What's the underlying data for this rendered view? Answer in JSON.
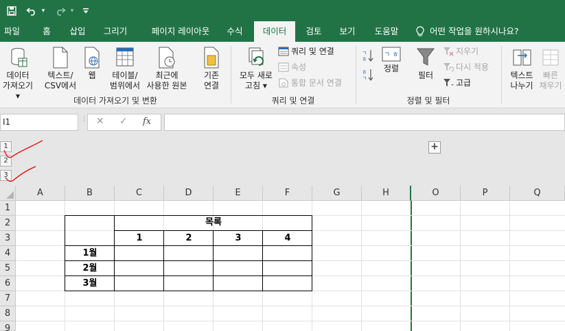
{
  "quick_access": {
    "save_icon": "save-icon",
    "undo_icon": "undo-icon",
    "redo_icon": "redo-icon",
    "customize_icon": "customize-icon",
    "dropdown_glyph": "▾"
  },
  "tabs": [
    "파일",
    "홈",
    "삽입",
    "그리기",
    "페이지 레이아웃",
    "수식",
    "데이터",
    "검토",
    "보기",
    "도움말"
  ],
  "active_tab": "데이터",
  "tell_me": "어떤 작업을 원하시나요?",
  "ribbon": {
    "get_data": {
      "line1": "데이터",
      "line2": "가져오기 ▾"
    },
    "from_text_csv": {
      "line1": "텍스트/",
      "line2": "CSV에서"
    },
    "from_web": "웹",
    "from_table": {
      "line1": "테이블/",
      "line2": "범위에서"
    },
    "recent_sources": {
      "line1": "최근에",
      "line2": "사용한 원본"
    },
    "existing_connections": {
      "line1": "기존",
      "line2": "연결"
    },
    "group_get_transform": "데이터 가져오기 및 변환",
    "refresh_all": {
      "line1": "모두 새로",
      "line2": "고침 ▾"
    },
    "queries_connections": "쿼리 및 연결",
    "properties": "속성",
    "edit_links": "통합 문서 연결",
    "group_queries": "쿼리 및 연결",
    "sort": "정렬",
    "filter": "필터",
    "clear": "지우기",
    "reapply": "다시 적용",
    "advanced": "고급",
    "group_sort_filter": "정렬 및 필터",
    "text_to_columns": {
      "line1": "텍스트",
      "line2": "나누기"
    },
    "flash_fill": {
      "line1": "빠른",
      "line2": "채우기"
    }
  },
  "formula_bar": {
    "name_box": "I1",
    "cancel": "✕",
    "enter": "✓",
    "fx": "fx",
    "value": ""
  },
  "outline": {
    "levels": [
      "1",
      "2",
      "3"
    ],
    "expand": "+"
  },
  "grid": {
    "columns": [
      "A",
      "B",
      "C",
      "D",
      "E",
      "F",
      "G",
      "H",
      "O",
      "P",
      "Q"
    ],
    "rows": [
      "1",
      "2",
      "3",
      "4",
      "5",
      "6",
      "7",
      "8",
      "9"
    ],
    "table": {
      "title": "목록",
      "headers": [
        "1",
        "2",
        "3",
        "4"
      ],
      "row_labels": [
        "1월",
        "2월",
        "3월"
      ]
    }
  },
  "colors": {
    "excel_green": "#217346",
    "annotation_red": "#e02020"
  }
}
